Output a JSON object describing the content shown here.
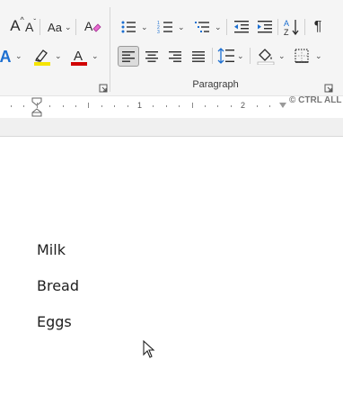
{
  "ribbon": {
    "font_group": {
      "grow_font_label": "A",
      "shrink_font_label": "A",
      "change_case_label": "Aa",
      "font_color_label": "A",
      "text_effects_label": "A",
      "highlight_color": "#f5e400",
      "font_color": "#d00000"
    },
    "paragraph_group": {
      "label": "Paragraph"
    }
  },
  "ruler": {
    "numbers": [
      "1",
      "2"
    ]
  },
  "watermark": {
    "text": "© CTRL ALL"
  },
  "document": {
    "paragraphs": [
      "Milk",
      "Bread",
      "Eggs"
    ]
  }
}
